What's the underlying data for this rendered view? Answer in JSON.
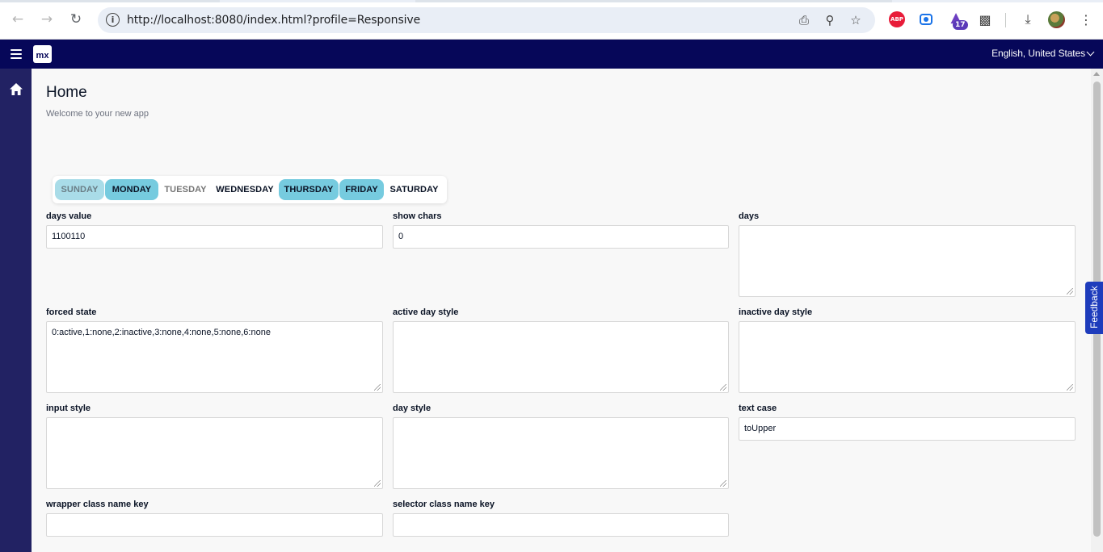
{
  "browser": {
    "url": "http://localhost:8080/index.html?profile=Responsive",
    "icons": {
      "back": "back-arrow-icon",
      "forward": "forward-arrow-icon",
      "reload": "reload-icon",
      "install": "install-app-icon",
      "zoom": "zoom-icon",
      "bookmark": "star-icon",
      "downloads": "download-icon",
      "menu": "kebab-menu-icon"
    },
    "extensions": {
      "abp_label": "ABP",
      "badge_count": "17"
    }
  },
  "app": {
    "logo_text": "mx",
    "language": "English, United States",
    "header_color": "#060759",
    "sidebar_color": "#222263"
  },
  "page": {
    "title": "Home",
    "subtitle": "Welcome to your new app"
  },
  "day_selector": {
    "days": [
      {
        "label": "SUNDAY",
        "state": "forced-active"
      },
      {
        "label": "MONDAY",
        "state": "active"
      },
      {
        "label": "TUESDAY",
        "state": "forced-inactive"
      },
      {
        "label": "WEDNESDAY",
        "state": "inactive"
      },
      {
        "label": "THURSDAY",
        "state": "active"
      },
      {
        "label": "FRIDAY",
        "state": "active"
      },
      {
        "label": "SATURDAY",
        "state": "inactive"
      }
    ],
    "active_color": "#76cbdf"
  },
  "fields": {
    "days_value": {
      "label": "days value",
      "value": "1100110"
    },
    "show_chars": {
      "label": "show chars",
      "value": "0"
    },
    "days": {
      "label": "days",
      "value": ""
    },
    "forced_state": {
      "label": "forced state",
      "value": "0:active,1:none,2:inactive,3:none,4:none,5:none,6:none"
    },
    "active_day_style": {
      "label": "active day style",
      "value": ""
    },
    "inactive_day_style": {
      "label": "inactive day style",
      "value": ""
    },
    "input_style": {
      "label": "input style",
      "value": ""
    },
    "day_style": {
      "label": "day style",
      "value": ""
    },
    "text_case": {
      "label": "text case",
      "value": "toUpper"
    },
    "wrapper_class_name_key": {
      "label": "wrapper class name key",
      "value": ""
    },
    "selector_class_name_key": {
      "label": "selector class name key",
      "value": ""
    }
  },
  "feedback": {
    "label": "Feedback"
  }
}
